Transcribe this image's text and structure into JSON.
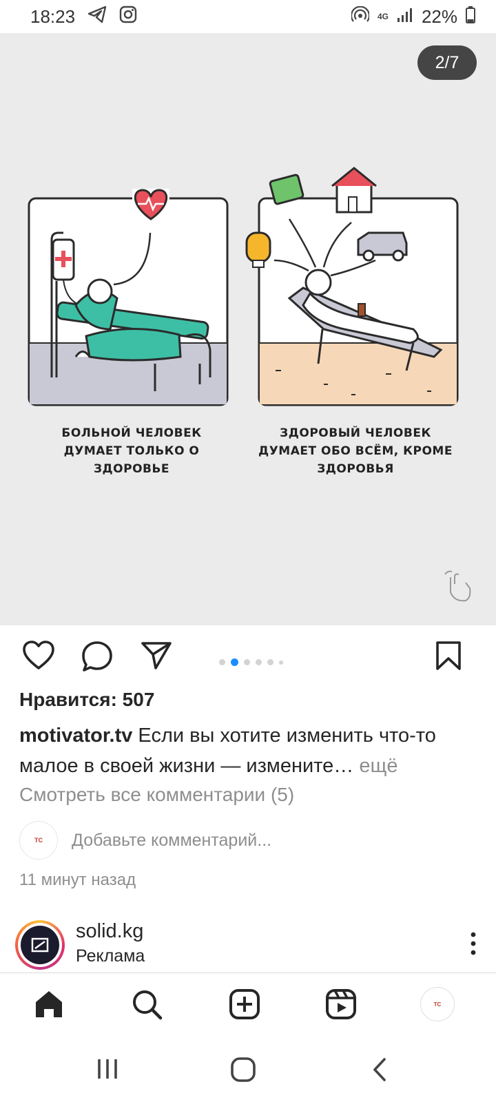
{
  "status_bar": {
    "time": "18:23",
    "network": "4G",
    "battery": "22%",
    "icons": [
      "telegram-icon",
      "instagram-icon",
      "hotspot-icon",
      "signal-icon",
      "battery-icon"
    ]
  },
  "post": {
    "counter": "2/7",
    "image": {
      "left_caption": [
        "БОЛЬНОЙ ЧЕЛОВЕК",
        "ДУМАЕТ ТОЛЬКО О",
        "ЗДОРОВЬЕ"
      ],
      "right_caption": [
        "ЗДОРОВЫЙ ЧЕЛОВЕК",
        "ДУМАЕТ ОБО ВСЁМ, КРОМЕ",
        "ЗДОРОВЬЯ"
      ]
    },
    "carousel": {
      "total_dots": 6,
      "active_index": 1
    },
    "likes": "Нравится: 507",
    "caption": {
      "username": "motivator.tv",
      "text": " Если вы хотите изменить что-то малое в своей жизни — измените…",
      "more": " ещё"
    },
    "view_comments": "Смотреть все комментарии (5)",
    "add_comment_placeholder": "Добавьте комментарий...",
    "timestamp": "11 минут назад",
    "avatar_text": "ТС"
  },
  "next_post": {
    "username": "solid.kg",
    "subtitle": "Реклама"
  },
  "bottom_nav": [
    "home-icon",
    "search-icon",
    "create-icon",
    "reels-icon",
    "profile-avatar"
  ],
  "colors": {
    "accent_blue": "#1a8cff",
    "heart_red": "#e8505b",
    "teal_blanket": "#3dbfa5",
    "sand": "#f6d7b8",
    "lavender_floor": "#c9c9d6"
  }
}
